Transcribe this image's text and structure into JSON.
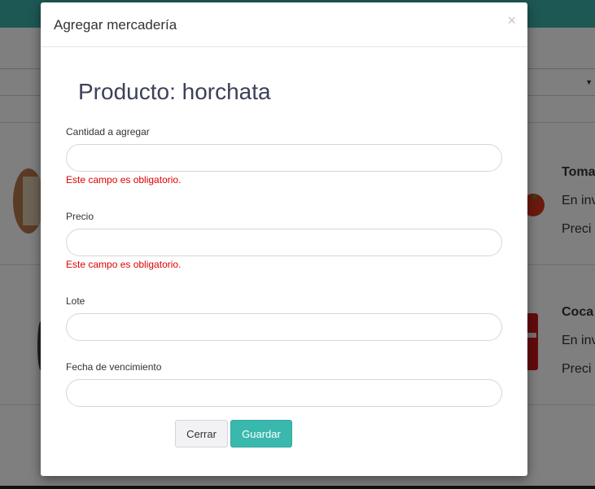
{
  "modal": {
    "title": "Agregar mercadería",
    "close_glyph": "×",
    "product_heading": "Producto: horchata",
    "fields": [
      {
        "label": "Cantidad a agregar",
        "value": "",
        "placeholder": "",
        "error": "Este campo es obligatorio."
      },
      {
        "label": "Precio",
        "value": "",
        "placeholder": "",
        "error": "Este campo es obligatorio."
      },
      {
        "label": "Lote",
        "value": "",
        "placeholder": ""
      },
      {
        "label": "Fecha de vencimiento",
        "value": "",
        "placeholder": ""
      }
    ],
    "buttons": {
      "close_label": "Cerrar",
      "save_label": "Guardar"
    }
  },
  "background": {
    "cards": [
      {
        "name": "Toma",
        "stock_label": "En inv",
        "price_label": "Preci"
      },
      {
        "name": "Coca",
        "stock_label": "En inv",
        "price_label": "Preci"
      }
    ],
    "select_caret_icon": "chevron-down-icon"
  },
  "colors": {
    "accent": "#3bb8ad",
    "error": "#e00000",
    "heading": "#3d4159"
  }
}
